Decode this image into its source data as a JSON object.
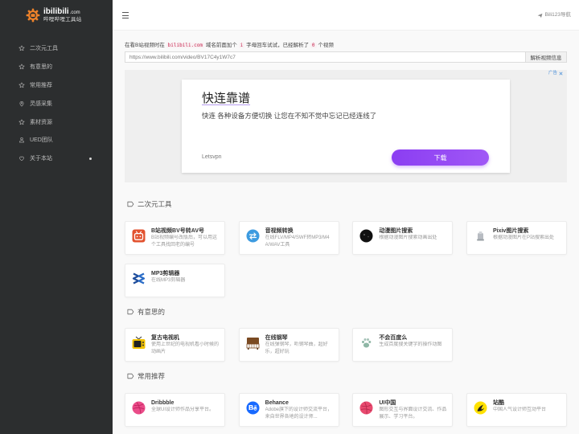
{
  "theme": {
    "sidebar_bg": "#2c2e2f",
    "logo_orange": "#f0832a",
    "code_red": "#c7254e",
    "ad_cta_purple": "#8b3ef2",
    "ad_choice_blue": "#4a90d9"
  },
  "logo": {
    "name": "ibilibili",
    "domain": ".com",
    "subtitle": "哔哩哔哩工具站",
    "icon": "gear-icon"
  },
  "sidebar": {
    "items": [
      {
        "label": "二次元工具",
        "icon": "star-icon"
      },
      {
        "label": "有意思的",
        "icon": "star-icon"
      },
      {
        "label": "常用推荐",
        "icon": "star-icon"
      },
      {
        "label": "灵感采集",
        "icon": "map-pin-icon"
      },
      {
        "label": "素材资源",
        "icon": "star-icon"
      },
      {
        "label": "UED团队",
        "icon": "user-icon"
      },
      {
        "label": "关于本站",
        "icon": "heart-icon"
      }
    ]
  },
  "header": {
    "menu_icon": "hamburger-icon",
    "nav_link": "Bili123导航",
    "nav_icon": "paper-plane-icon"
  },
  "parser": {
    "intro_before": "在看B站视频时在",
    "domain_code": "bilibili.com",
    "intro_mid": "域名前面加个",
    "letter_code": "i",
    "intro_after": "字母回车试试，已经解析了",
    "count": "0",
    "intro_end": "个视频",
    "input_placeholder": "https://www.bilibili.com/video/BV17C4y1W7c7",
    "button_label": "解析视频信息"
  },
  "ad": {
    "label": "广告",
    "close_icon": "close-icon",
    "headline": "快连靠谱",
    "description": "快连 各种设备方便切换 让您在不知不觉中忘记已经连线了",
    "advertiser": "Letsvpn",
    "cta": "下载"
  },
  "sections": [
    {
      "title": "二次元工具",
      "icon": "tag-icon",
      "cards": [
        {
          "title": "B站视频BV号转AV号",
          "desc": "B站视频编号改版后，可以用这个工具找回老的编号",
          "icon": "bv-to-av-icon",
          "color": "#e2522f"
        },
        {
          "title": "音视频转换",
          "desc": "在线FLV/MP4/SWF转MP3/M4A/WAV工具",
          "icon": "convert-arrows-icon",
          "color": "#3d9be0"
        },
        {
          "title": "动漫图片搜索",
          "desc": "根据动漫图片搜索动画出处",
          "icon": "anime-search-icon",
          "color": "#111111"
        },
        {
          "title": "Pixiv图片搜索",
          "desc": "根据动漫图片在P站搜索出处",
          "icon": "pixiv-icon",
          "color": "#b8bcc2"
        },
        {
          "title": "MP3剪辑器",
          "desc": "在线MP3剪辑器",
          "icon": "mp3-cutter-icon",
          "color": "#1f4e9c"
        }
      ]
    },
    {
      "title": "有意思的",
      "icon": "tag-icon",
      "cards": [
        {
          "title": "复古电视机",
          "desc": "使用上世纪的电视机看小时候的动画片",
          "icon": "retro-tv-icon",
          "color": "#f2c200"
        },
        {
          "title": "在线钢琴",
          "desc": "在线弹钢琴，听钢琴曲，超好乐，超好玩",
          "icon": "piano-icon",
          "color": "#7a4a22"
        },
        {
          "title": "不会百度么",
          "desc": "生成百度搜关键字的操作动图",
          "icon": "baidu-paw-icon",
          "color": "#8fb7a6"
        }
      ]
    },
    {
      "title": "常用推荐",
      "icon": "tag-icon",
      "cards": [
        {
          "title": "Dribbble",
          "desc": "全球UI设计师作品分享平台。",
          "icon": "dribbble-icon",
          "color": "#ea4c89"
        },
        {
          "title": "Behance",
          "desc": "Adobe旗下的设计师交流平台，来自世界各地的设计师...",
          "icon": "behance-icon",
          "color": "#1769ff"
        },
        {
          "title": "UI中国",
          "desc": "图形交互与界面设计交流、作品展示、学习平台。",
          "icon": "ui-china-icon",
          "color": "#e84a6f"
        },
        {
          "title": "站酷",
          "desc": "中国人气设计师互动平台",
          "icon": "zcool-icon",
          "color": "#ffe100"
        }
      ]
    }
  ]
}
